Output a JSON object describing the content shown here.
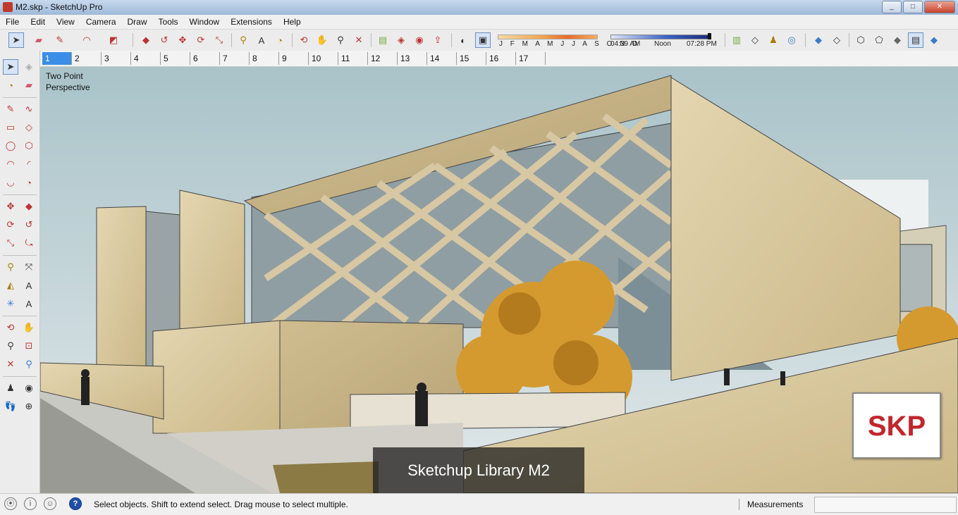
{
  "window": {
    "title": "M2.skp - SketchUp Pro",
    "minimize": "_",
    "maximize": "□",
    "close": "✕"
  },
  "menu": [
    "File",
    "Edit",
    "View",
    "Camera",
    "Draw",
    "Tools",
    "Window",
    "Extensions",
    "Help"
  ],
  "shadow": {
    "months": "J F M A M J J A S O N D",
    "time_start": "04:39 AM",
    "time_mid": "Noon",
    "time_end": "07:28 PM"
  },
  "scenes": [
    "1",
    "2",
    "3",
    "4",
    "5",
    "6",
    "7",
    "8",
    "9",
    "10",
    "11",
    "12",
    "13",
    "14",
    "15",
    "16",
    "17"
  ],
  "active_scene": "1",
  "viewport": {
    "camera_label": "Two Point\nPerspective",
    "caption": "Sketchup Library M2",
    "logo_text": "SKP"
  },
  "status": {
    "hint": "Select objects. Shift to extend select. Drag mouse to select multiple.",
    "measurements_label": "Measurements",
    "measurements_value": ""
  },
  "colors": {
    "accent_tab": "#3a8ee6",
    "sky": "#cfdbe0",
    "stone": "#d9c8a0",
    "tree": "#d99a2b",
    "logo_red": "#c0272d"
  }
}
